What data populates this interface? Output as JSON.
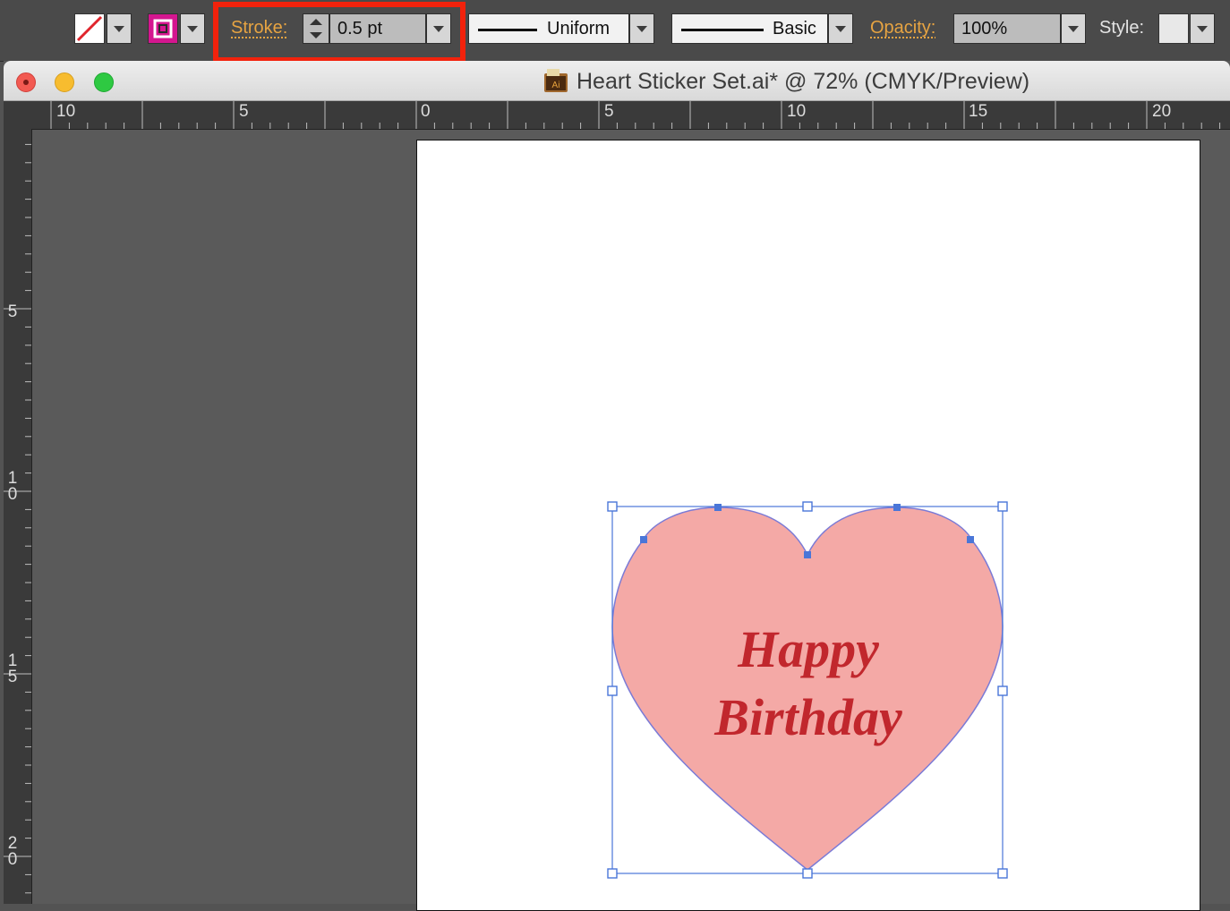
{
  "control_bar": {
    "fill_swatch_icon": "no-fill-icon",
    "stroke_swatch_icon": "stroke-color-icon",
    "stroke_color": "#d4168f",
    "stroke_label": "Stroke:",
    "stroke_weight": "0.5 pt",
    "variable_width_profile": "Uniform",
    "brush_definition": "Basic",
    "opacity_label": "Opacity:",
    "opacity_value": "100%",
    "style_label": "Style:"
  },
  "document": {
    "title": "Heart Sticker Set.ai* @ 72% (CMYK/Preview)",
    "file_icon_label": "Ai"
  },
  "rulers": {
    "horizontal_labels": [
      "10",
      "5",
      "0",
      "5",
      "10",
      "15",
      "20"
    ],
    "vertical_labels": [
      "5",
      "10",
      "15",
      "20"
    ]
  },
  "artwork": {
    "heart_fill": "#f4a9a6",
    "heart_stroke": "#7b7bd6",
    "text_line1": "Happy",
    "text_line2": "Birthday",
    "text_color": "#c1272d",
    "selection_color": "#4a76d8"
  }
}
